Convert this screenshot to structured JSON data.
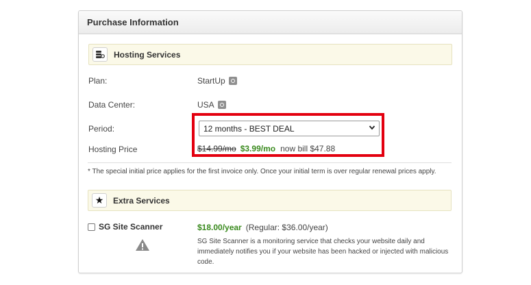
{
  "panel": {
    "title": "Purchase Information"
  },
  "hosting": {
    "section_title": "Hosting Services",
    "icon": "server-icon",
    "plan_label": "Plan:",
    "plan_value": "StartUp",
    "datacenter_label": "Data Center:",
    "datacenter_value": "USA",
    "period_label": "Period:",
    "period_selected": "12 months - BEST DEAL",
    "price_label": "Hosting Price",
    "old_price": "$14.99/mo",
    "new_price": "$3.99/mo",
    "bill_text": "now bill $47.88",
    "highlight_color": "#e3000f",
    "price_color": "#3a8a1e"
  },
  "note": "* The special initial price applies for the first invoice only. Once your initial term is over regular renewal prices apply.",
  "extras": {
    "section_title": "Extra Services",
    "icon": "star-icon",
    "scanner_label": "SG Site Scanner",
    "scanner_price": "$18.00/year",
    "scanner_regular": "(Regular: $36.00/year)",
    "scanner_description": "SG Site Scanner is a monitoring service that checks your website daily and immediately notifies you if your website has been hacked or injected with malicious code.",
    "warning_icon": "warning-icon"
  }
}
